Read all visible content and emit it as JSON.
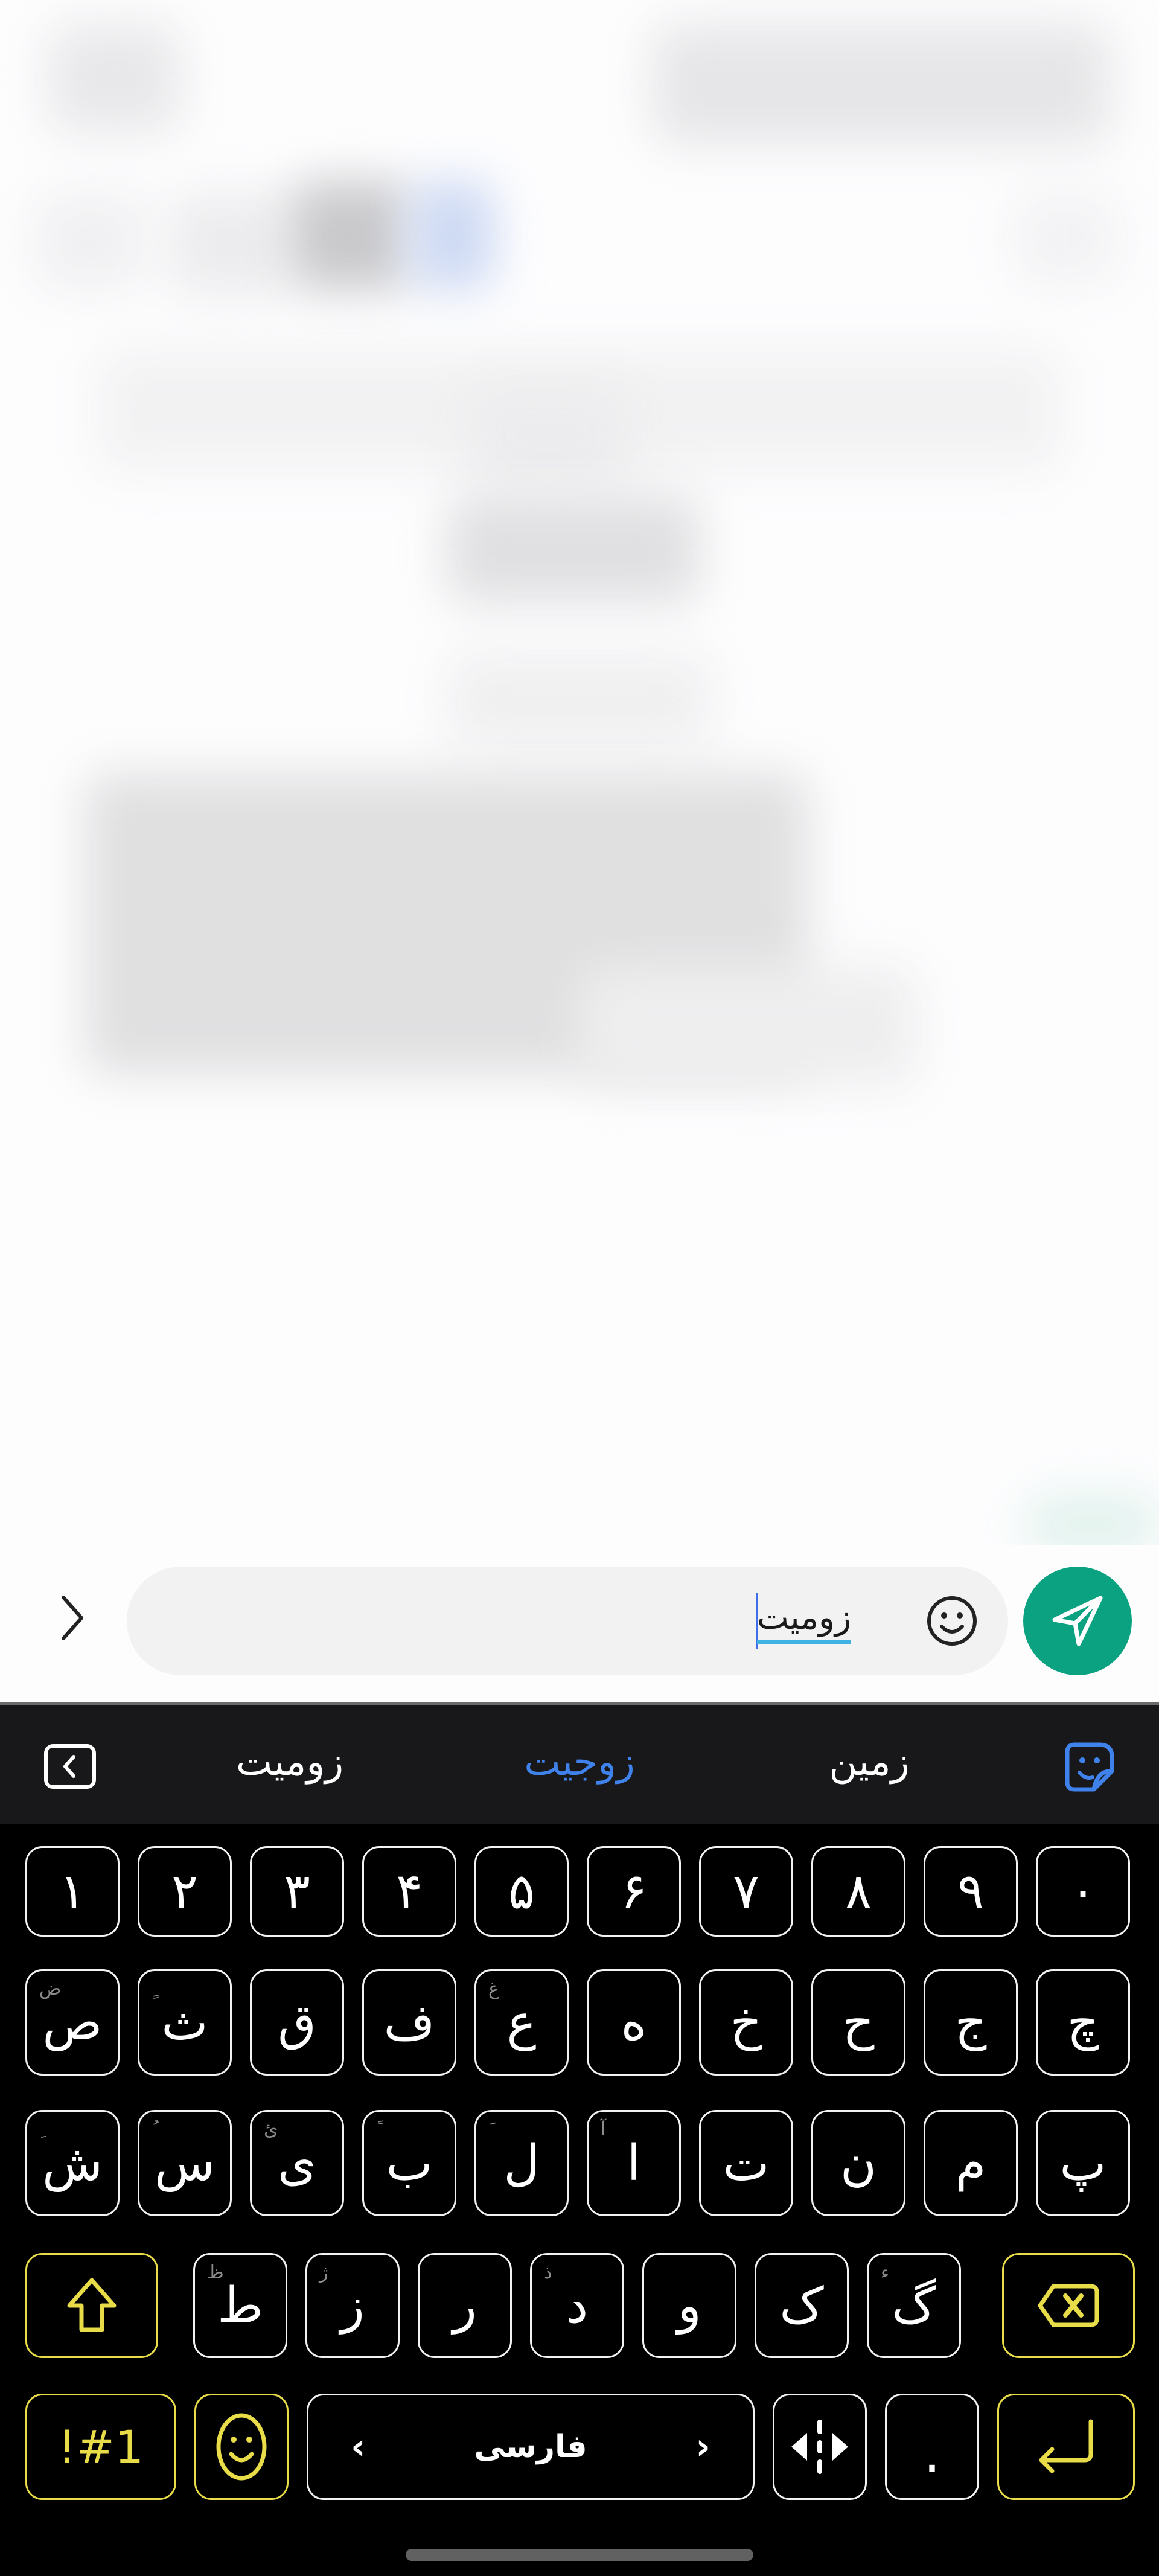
{
  "composer": {
    "expand_icon": "chevron-right-icon",
    "input_value": "زومیت",
    "emoji_icon": "smiley-icon",
    "send_icon": "send-paper-plane-icon"
  },
  "colors": {
    "send_button": "#0aa281",
    "suggestion_active": "#3f82ec",
    "function_key_accent": "#e8dc48",
    "keyboard_bg": "#000000",
    "suggestion_bar_bg": "#18181a",
    "input_bg": "#f2f2f3",
    "caret": "#3f6fe8",
    "composing_underline": "#3fb1e3"
  },
  "keyboard": {
    "toolbar_icon": "collapse-toolbar-icon",
    "sticker_icon": "sticker-icon",
    "suggestions": [
      {
        "label": "زومیت",
        "active": false
      },
      {
        "label": "زوجیت",
        "active": true
      },
      {
        "label": "زمین",
        "active": false
      }
    ],
    "rows": [
      [
        {
          "main": "۱"
        },
        {
          "main": "۲"
        },
        {
          "main": "۳"
        },
        {
          "main": "۴"
        },
        {
          "main": "۵"
        },
        {
          "main": "۶"
        },
        {
          "main": "۷"
        },
        {
          "main": "۸"
        },
        {
          "main": "۹"
        },
        {
          "main": "۰"
        }
      ],
      [
        {
          "main": "ص",
          "alt": "ض"
        },
        {
          "main": "ث",
          "alt": "ٍ"
        },
        {
          "main": "ق"
        },
        {
          "main": "ف"
        },
        {
          "main": "ع",
          "alt": "غ"
        },
        {
          "main": "ه"
        },
        {
          "main": "خ"
        },
        {
          "main": "ح"
        },
        {
          "main": "ج"
        },
        {
          "main": "چ"
        }
      ],
      [
        {
          "main": "ش",
          "alt": "ِ"
        },
        {
          "main": "س",
          "alt": "ُ"
        },
        {
          "main": "ی",
          "alt": "ئ"
        },
        {
          "main": "ب",
          "alt": "ً"
        },
        {
          "main": "ل",
          "alt": "َ"
        },
        {
          "main": "ا",
          "alt": "آ"
        },
        {
          "main": "ت"
        },
        {
          "main": "ن"
        },
        {
          "main": "م"
        },
        {
          "main": "پ"
        }
      ],
      [
        {
          "main": "ط",
          "alt": "ظ"
        },
        {
          "main": "ز",
          "alt": "ژ"
        },
        {
          "main": "ر"
        },
        {
          "main": "د",
          "alt": "ذ"
        },
        {
          "main": "و"
        },
        {
          "main": "ک"
        },
        {
          "main": "گ",
          "alt": "ء"
        }
      ]
    ],
    "shift_icon": "shift-arrow-up-icon",
    "backspace_icon": "backspace-icon",
    "symbols_label": "!#1",
    "emoji_key_icon": "smiley-icon",
    "space_label": "فارسی",
    "space_left_icon": "chevron-left-icon",
    "space_right_icon": "chevron-right-icon",
    "cursor_move_icon": "cursor-move-icon",
    "period_label": ".",
    "enter_icon": "enter-return-icon"
  }
}
